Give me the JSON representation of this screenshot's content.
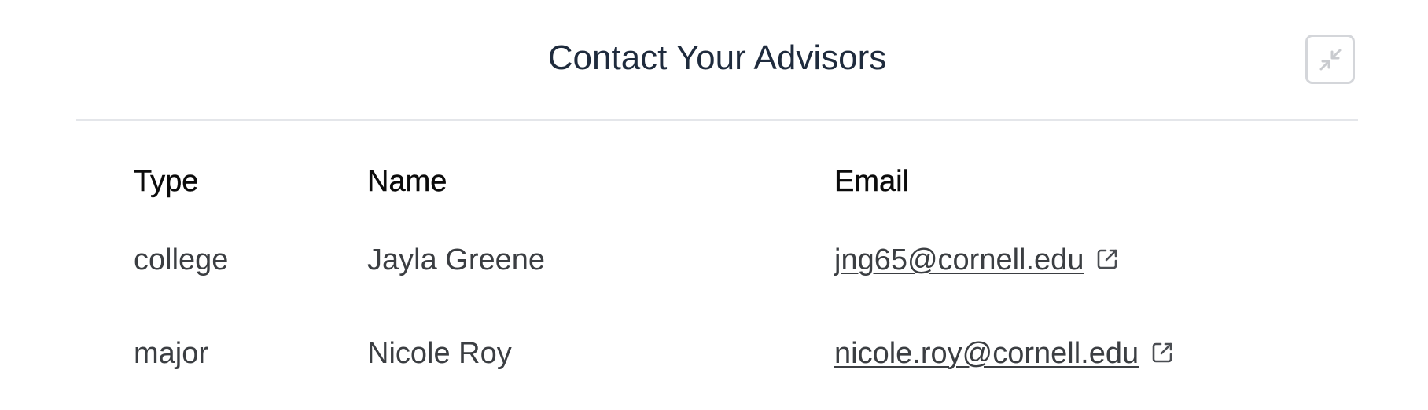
{
  "modal": {
    "title": "Contact Your Advisors",
    "collapse_icon": "collapse-arrows-icon"
  },
  "table": {
    "headers": {
      "type": "Type",
      "name": "Name",
      "email": "Email"
    },
    "rows": [
      {
        "type": "college",
        "name": "Jayla Greene",
        "email": "jng65@cornell.edu",
        "email_icon": "external-link-icon"
      },
      {
        "type": "major",
        "name": "Nicole Roy",
        "email": "nicole.roy@cornell.edu",
        "email_icon": "external-link-icon"
      }
    ]
  },
  "colors": {
    "title": "#1f2b3d",
    "text": "#3b3e42",
    "header_text": "#0b0b0b",
    "divider": "#e4e6ea",
    "button_border": "#d4d6da"
  }
}
